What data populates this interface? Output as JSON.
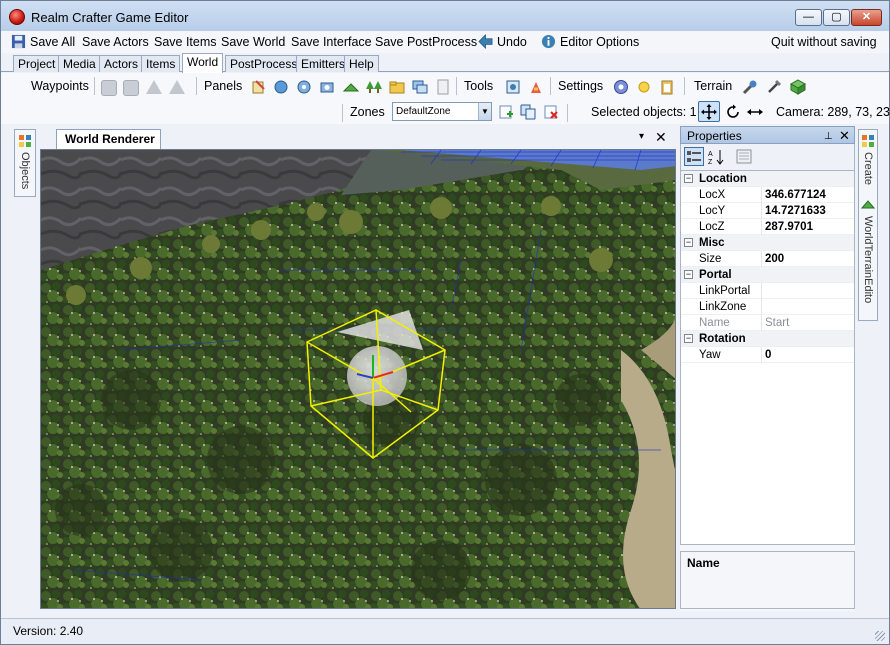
{
  "window": {
    "title": "Realm Crafter Game Editor",
    "min": "—",
    "max": "▢",
    "close": "✕"
  },
  "menu": {
    "save_all": "Save All",
    "save_actors": "Save Actors",
    "save_items": "Save Items",
    "save_world": "Save World",
    "save_interface": "Save Interface",
    "save_postprocess": "Save PostProcess",
    "undo": "Undo",
    "editor_options": "Editor Options",
    "quit": "Quit without saving"
  },
  "tabs": [
    "Project",
    "Media",
    "Actors",
    "Items",
    "World",
    "PostProcess",
    "Emitters",
    "Help"
  ],
  "active_tab": "World",
  "toolbar": {
    "waypoints": "Waypoints",
    "panels": "Panels",
    "tools": "Tools",
    "settings": "Settings",
    "terrain": "Terrain",
    "zones_label": "Zones",
    "zone_value": "DefaultZone",
    "selected_objects": "Selected objects: 1",
    "camera": "Camera: 289, 73, 23"
  },
  "left_panel": {
    "objects_tab": "Objects"
  },
  "document": {
    "tab": "World Renderer",
    "dropdown": "▾",
    "close": "✕"
  },
  "properties": {
    "title": "Properties",
    "pin": "📌",
    "close": "✕",
    "rows": [
      {
        "type": "category",
        "name": "Location"
      },
      {
        "type": "prop",
        "name": "LocX",
        "value": "346.677124"
      },
      {
        "type": "prop",
        "name": "LocY",
        "value": "14.7271633"
      },
      {
        "type": "prop",
        "name": "LocZ",
        "value": "287.9701"
      },
      {
        "type": "category",
        "name": "Misc"
      },
      {
        "type": "prop",
        "name": "Size",
        "value": "200"
      },
      {
        "type": "category",
        "name": "Portal"
      },
      {
        "type": "prop",
        "name": "LinkPortal",
        "value": ""
      },
      {
        "type": "prop",
        "name": "LinkZone",
        "value": ""
      },
      {
        "type": "disabled",
        "name": "Name",
        "value": "Start"
      },
      {
        "type": "category",
        "name": "Rotation"
      },
      {
        "type": "prop",
        "name": "Yaw",
        "value": "0"
      }
    ],
    "description_title": "Name"
  },
  "right_panel": {
    "create_tab": "Create",
    "terrain_tab": "WorldTerrainEdito"
  },
  "status": {
    "version": "Version: 2.40"
  },
  "colors": {
    "accent": "#3c7fb1",
    "selection_box": "#f4f000"
  }
}
